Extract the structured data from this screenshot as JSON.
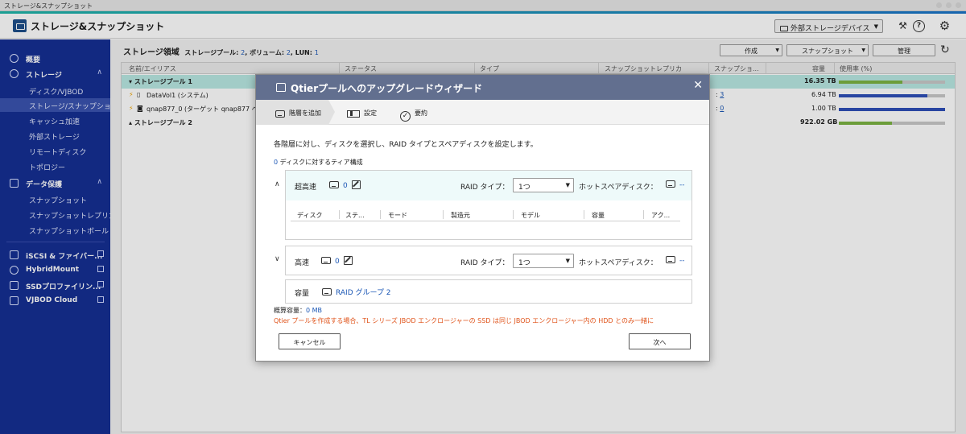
{
  "window": {
    "title": "ストレージ&スナップショット"
  },
  "header": {
    "app_title": "ストレージ&スナップショット",
    "external_device_button": "外部ストレージデバイス",
    "icons": [
      "tools-icon",
      "help-icon",
      "gear-icon"
    ]
  },
  "sidebar": {
    "overview": "概要",
    "storage": "ストレージ",
    "storage_items": [
      "ディスク/VJBOD",
      "ストレージ/スナップショ...",
      "キャッシュ加速",
      "外部ストレージ",
      "リモートディスク",
      "トポロジー"
    ],
    "data_protection": "データ保護",
    "data_protection_items": [
      "スナップショット",
      "スナップショットレプリカ",
      "スナップショットボールト"
    ],
    "apps": [
      "iSCSI & ファイバー...",
      "HybridMount",
      "SSDプロファイリン...",
      "VJBOD Cloud"
    ]
  },
  "main": {
    "title": "ストレージ領域",
    "summary_pool_label": "ストレージプール:",
    "summary_pool_value": "2",
    "summary_volume_label": "ボリューム:",
    "summary_volume_value": "2",
    "summary_lun_label": "LUN:",
    "summary_lun_value": "1",
    "buttons": {
      "create": "作成",
      "snapshot": "スナップショット",
      "manage": "管理"
    },
    "columns": [
      "名前/エイリアス",
      "ステータス",
      "タイプ",
      "スナップショットレプリカ",
      "スナップショ...",
      "容量",
      "使用率 (%)"
    ],
    "rows": [
      {
        "name": "ストレージプール 1",
        "capacity": "16.35 TB",
        "snap": "",
        "usage": 0.6
      },
      {
        "name": "DataVol1 (システム)",
        "capacity": "6.94 TB",
        "snap": "3",
        "usage": 0.83
      },
      {
        "name": "qnap877_0 (ターゲット qnap877 へ",
        "capacity": "1.00 TB",
        "snap": "0",
        "usage": 1.0
      },
      {
        "name": "ストレージプール 2",
        "capacity": "922.02 GB",
        "snap": "",
        "usage": 0.5
      }
    ]
  },
  "modal": {
    "title": "Qtierプールへのアップグレードウィザード",
    "steps": [
      "階層を追加",
      "設定",
      "要約"
    ],
    "description": "各階層に対し、ディスクを選択し、RAID タイプとスペアディスクを設定します。",
    "tier_count_value": "0",
    "tier_count_label": "ディスクに対するティア構成",
    "tiers": [
      {
        "name": "超高速",
        "disk_count": "0",
        "raid_label": "RAID タイプ：",
        "raid_value": "1つ",
        "spare_label": "ホットスペアディスク：",
        "spare_value": "--"
      },
      {
        "name": "高速",
        "disk_count": "0",
        "raid_label": "RAID タイプ：",
        "raid_value": "1つ",
        "spare_label": "ホットスペアディスク：",
        "spare_value": "--"
      }
    ],
    "disk_table_columns": [
      "ディスク",
      "ステ...",
      "モード",
      "製造元",
      "モデル",
      "容量",
      "アク..."
    ],
    "capacity_label": "容量",
    "capacity_value": "RAID グループ 2",
    "estimate_label": "概算容量：",
    "estimate_value": "0 MB",
    "warning": "Qtier プールを作成する場合、TL シリーズ JBOD エンクロージャーの SSD は同じ JBOD エンクロージャー内の HDD とのみ一緒に",
    "cancel_button": "キャンセル",
    "next_button": "次へ"
  },
  "colors": {
    "sidebar": "#152f93",
    "modal_header": "#626f8f",
    "link": "#1b57b5",
    "warning": "#e0541b",
    "selected_row": "#b9e9e3"
  }
}
